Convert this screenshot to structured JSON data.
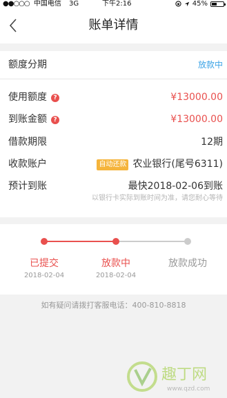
{
  "status_bar": {
    "signal": "●●○○○",
    "carrier": "中国电信",
    "network": "3G",
    "time": "下午2:16",
    "battery": "45%",
    "battery_level": 0.45,
    "icons": [
      "lock-rotation-icon",
      "location-arrow-icon",
      "battery-icon"
    ]
  },
  "nav": {
    "title": "账单详情",
    "back_icon": "chevron-left-icon"
  },
  "installment": {
    "label": "额度分期",
    "status": "放款中"
  },
  "details": {
    "used_amount": {
      "label": "使用额度",
      "value": "¥13000.00",
      "icon": "question-icon"
    },
    "received_amount": {
      "label": "到账金额",
      "value": "¥13000.00",
      "icon": "question-icon"
    },
    "term": {
      "label": "借款期限",
      "value": "12期"
    },
    "account": {
      "label": "收款账户",
      "badge": "自动还款",
      "value": "农业银行(尾号6311)"
    },
    "expected": {
      "label": "预计到账",
      "value": "最快2018-02-06到账",
      "note": "以银行卡实际到账时间为准，请您耐心等待"
    }
  },
  "progress": {
    "steps": [
      {
        "name": "已提交",
        "date": "2018-02-04",
        "state": "done"
      },
      {
        "name": "放款中",
        "date": "2018-02-04",
        "state": "current"
      },
      {
        "name": "放款成功",
        "date": "",
        "state": "pending"
      }
    ]
  },
  "footer": {
    "hotline": "如有疑问请拨打客服电话：400-810-8818"
  },
  "watermark": {
    "brand": "趣丁网",
    "url": "www.qzd.com"
  },
  "colors": {
    "accent_red": "#e9504e",
    "link_blue": "#3ba3e6",
    "badge_orange": "#f5b43b",
    "pending_gray": "#cccccc"
  }
}
